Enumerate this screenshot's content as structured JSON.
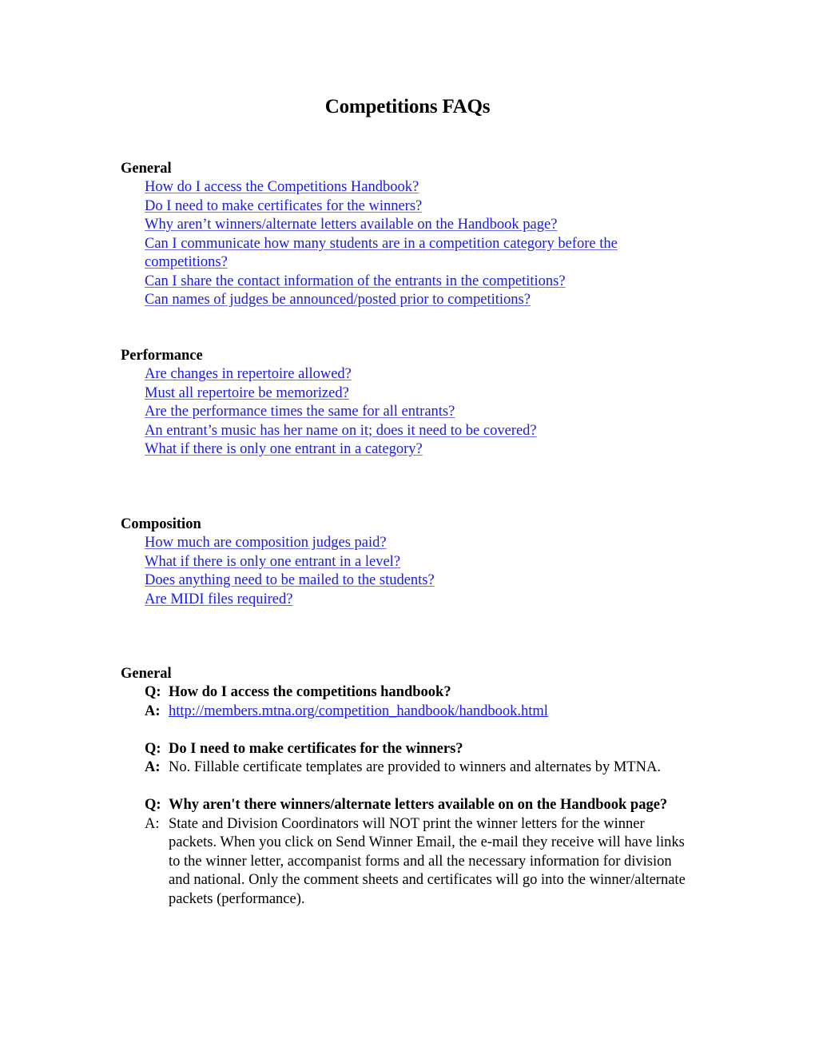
{
  "title": "Competitions FAQs",
  "toc": [
    {
      "heading": "General",
      "links": [
        "How do I access the Competitions Handbook?",
        "Do I need to make certificates for the winners?",
        "Why aren’t winners/alternate letters available on the Handbook page?",
        "Can I communicate how many students are in a competition category before the competitions?",
        "Can I share the contact information of the entrants in the competitions?",
        "Can names of judges be announced/posted prior to competitions?"
      ]
    },
    {
      "heading": "Performance",
      "links": [
        "Are changes in repertoire allowed?",
        "Must all repertoire be memorized?",
        "Are the performance times the same for all entrants?",
        "An entrant’s music has her name on it; does it need to be covered?",
        "What if there is only one entrant in a category?"
      ]
    },
    {
      "heading": "Composition",
      "links": [
        "How much are composition judges paid?",
        "What if there is only one entrant in a level?",
        "Does anything need to be mailed to the students?",
        "Are MIDI files required?"
      ]
    }
  ],
  "answers_section": {
    "heading": "General",
    "q_label": "Q:",
    "a_label": "A:",
    "items": [
      {
        "question": "How do I access the competitions handbook?",
        "answer_link": "http://members.mtna.org/competition_handbook/handbook.html"
      },
      {
        "question": "Do I need to make certificates for the winners?",
        "answer": "No. Fillable certificate templates are provided to winners and alternates by MTNA."
      },
      {
        "question": "Why aren't there winners/alternate letters available on on the Handbook page?",
        "answer": "State and Division Coordinators will NOT print the winner letters for the winner packets. When you click on Send Winner Email, the e-mail they receive will have links to the winner letter, accompanist forms and all the necessary information for division and national. Only the comment sheets and certificates will go into the winner/alternate packets (performance)."
      }
    ]
  }
}
